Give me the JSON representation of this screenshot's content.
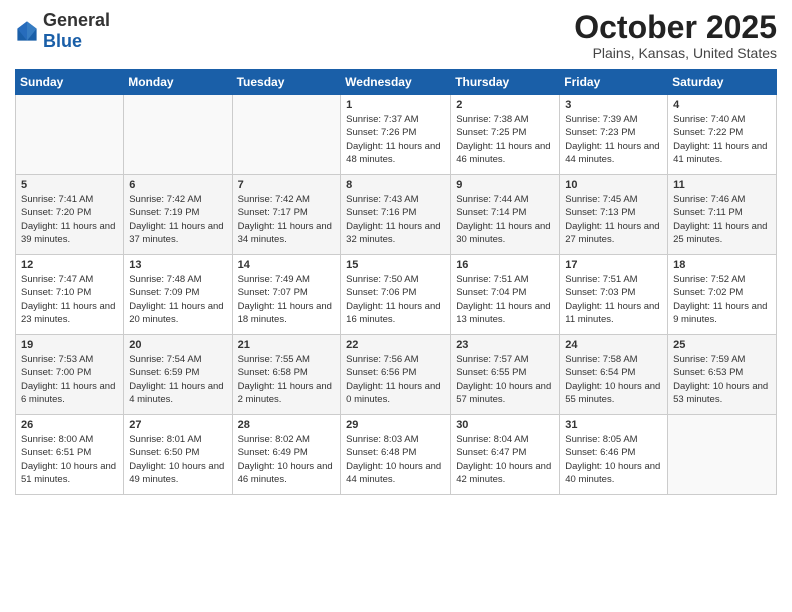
{
  "logo": {
    "general": "General",
    "blue": "Blue"
  },
  "header": {
    "month": "October 2025",
    "location": "Plains, Kansas, United States"
  },
  "weekdays": [
    "Sunday",
    "Monday",
    "Tuesday",
    "Wednesday",
    "Thursday",
    "Friday",
    "Saturday"
  ],
  "weeks": [
    [
      {
        "day": "",
        "info": ""
      },
      {
        "day": "",
        "info": ""
      },
      {
        "day": "",
        "info": ""
      },
      {
        "day": "1",
        "info": "Sunrise: 7:37 AM\nSunset: 7:26 PM\nDaylight: 11 hours\nand 48 minutes."
      },
      {
        "day": "2",
        "info": "Sunrise: 7:38 AM\nSunset: 7:25 PM\nDaylight: 11 hours\nand 46 minutes."
      },
      {
        "day": "3",
        "info": "Sunrise: 7:39 AM\nSunset: 7:23 PM\nDaylight: 11 hours\nand 44 minutes."
      },
      {
        "day": "4",
        "info": "Sunrise: 7:40 AM\nSunset: 7:22 PM\nDaylight: 11 hours\nand 41 minutes."
      }
    ],
    [
      {
        "day": "5",
        "info": "Sunrise: 7:41 AM\nSunset: 7:20 PM\nDaylight: 11 hours\nand 39 minutes."
      },
      {
        "day": "6",
        "info": "Sunrise: 7:42 AM\nSunset: 7:19 PM\nDaylight: 11 hours\nand 37 minutes."
      },
      {
        "day": "7",
        "info": "Sunrise: 7:42 AM\nSunset: 7:17 PM\nDaylight: 11 hours\nand 34 minutes."
      },
      {
        "day": "8",
        "info": "Sunrise: 7:43 AM\nSunset: 7:16 PM\nDaylight: 11 hours\nand 32 minutes."
      },
      {
        "day": "9",
        "info": "Sunrise: 7:44 AM\nSunset: 7:14 PM\nDaylight: 11 hours\nand 30 minutes."
      },
      {
        "day": "10",
        "info": "Sunrise: 7:45 AM\nSunset: 7:13 PM\nDaylight: 11 hours\nand 27 minutes."
      },
      {
        "day": "11",
        "info": "Sunrise: 7:46 AM\nSunset: 7:11 PM\nDaylight: 11 hours\nand 25 minutes."
      }
    ],
    [
      {
        "day": "12",
        "info": "Sunrise: 7:47 AM\nSunset: 7:10 PM\nDaylight: 11 hours\nand 23 minutes."
      },
      {
        "day": "13",
        "info": "Sunrise: 7:48 AM\nSunset: 7:09 PM\nDaylight: 11 hours\nand 20 minutes."
      },
      {
        "day": "14",
        "info": "Sunrise: 7:49 AM\nSunset: 7:07 PM\nDaylight: 11 hours\nand 18 minutes."
      },
      {
        "day": "15",
        "info": "Sunrise: 7:50 AM\nSunset: 7:06 PM\nDaylight: 11 hours\nand 16 minutes."
      },
      {
        "day": "16",
        "info": "Sunrise: 7:51 AM\nSunset: 7:04 PM\nDaylight: 11 hours\nand 13 minutes."
      },
      {
        "day": "17",
        "info": "Sunrise: 7:51 AM\nSunset: 7:03 PM\nDaylight: 11 hours\nand 11 minutes."
      },
      {
        "day": "18",
        "info": "Sunrise: 7:52 AM\nSunset: 7:02 PM\nDaylight: 11 hours\nand 9 minutes."
      }
    ],
    [
      {
        "day": "19",
        "info": "Sunrise: 7:53 AM\nSunset: 7:00 PM\nDaylight: 11 hours\nand 6 minutes."
      },
      {
        "day": "20",
        "info": "Sunrise: 7:54 AM\nSunset: 6:59 PM\nDaylight: 11 hours\nand 4 minutes."
      },
      {
        "day": "21",
        "info": "Sunrise: 7:55 AM\nSunset: 6:58 PM\nDaylight: 11 hours\nand 2 minutes."
      },
      {
        "day": "22",
        "info": "Sunrise: 7:56 AM\nSunset: 6:56 PM\nDaylight: 11 hours\nand 0 minutes."
      },
      {
        "day": "23",
        "info": "Sunrise: 7:57 AM\nSunset: 6:55 PM\nDaylight: 10 hours\nand 57 minutes."
      },
      {
        "day": "24",
        "info": "Sunrise: 7:58 AM\nSunset: 6:54 PM\nDaylight: 10 hours\nand 55 minutes."
      },
      {
        "day": "25",
        "info": "Sunrise: 7:59 AM\nSunset: 6:53 PM\nDaylight: 10 hours\nand 53 minutes."
      }
    ],
    [
      {
        "day": "26",
        "info": "Sunrise: 8:00 AM\nSunset: 6:51 PM\nDaylight: 10 hours\nand 51 minutes."
      },
      {
        "day": "27",
        "info": "Sunrise: 8:01 AM\nSunset: 6:50 PM\nDaylight: 10 hours\nand 49 minutes."
      },
      {
        "day": "28",
        "info": "Sunrise: 8:02 AM\nSunset: 6:49 PM\nDaylight: 10 hours\nand 46 minutes."
      },
      {
        "day": "29",
        "info": "Sunrise: 8:03 AM\nSunset: 6:48 PM\nDaylight: 10 hours\nand 44 minutes."
      },
      {
        "day": "30",
        "info": "Sunrise: 8:04 AM\nSunset: 6:47 PM\nDaylight: 10 hours\nand 42 minutes."
      },
      {
        "day": "31",
        "info": "Sunrise: 8:05 AM\nSunset: 6:46 PM\nDaylight: 10 hours\nand 40 minutes."
      },
      {
        "day": "",
        "info": ""
      }
    ]
  ]
}
